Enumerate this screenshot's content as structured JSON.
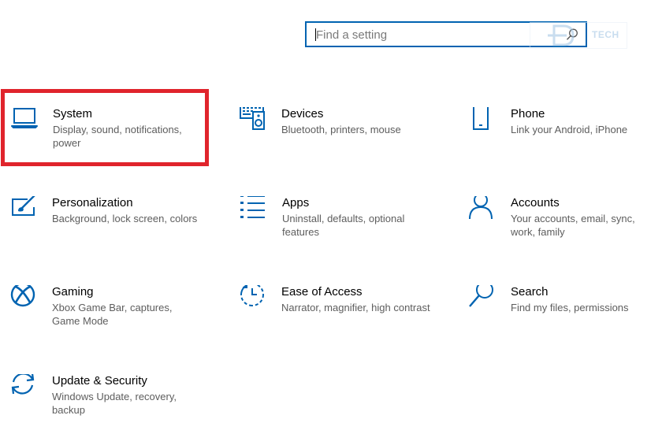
{
  "search": {
    "placeholder": "Find a setting",
    "value": ""
  },
  "watermark": {
    "text": "TECH"
  },
  "colors": {
    "accent": "#0063b1",
    "highlight": "#e0242c",
    "description": "#5d5d5d"
  },
  "categories": [
    {
      "id": "system",
      "icon": "laptop-icon",
      "title": "System",
      "description": "Display, sound, notifications, power",
      "highlighted": true
    },
    {
      "id": "devices",
      "icon": "keyboard-speaker-icon",
      "title": "Devices",
      "description": "Bluetooth, printers, mouse"
    },
    {
      "id": "phone",
      "icon": "phone-icon",
      "title": "Phone",
      "description": "Link your Android, iPhone"
    },
    {
      "id": "personalization",
      "icon": "paintbrush-icon",
      "title": "Personalization",
      "description": "Background, lock screen, colors"
    },
    {
      "id": "apps",
      "icon": "apps-list-icon",
      "title": "Apps",
      "description": "Uninstall, defaults, optional features"
    },
    {
      "id": "accounts",
      "icon": "person-icon",
      "title": "Accounts",
      "description": "Your accounts, email, sync, work, family"
    },
    {
      "id": "gaming",
      "icon": "xbox-icon",
      "title": "Gaming",
      "description": "Xbox Game Bar, captures, Game Mode"
    },
    {
      "id": "ease-of-access",
      "icon": "ease-of-access-icon",
      "title": "Ease of Access",
      "description": "Narrator, magnifier, high contrast"
    },
    {
      "id": "search",
      "icon": "magnifier-icon",
      "title": "Search",
      "description": "Find my files, permissions"
    },
    {
      "id": "update-security",
      "icon": "sync-arrows-icon",
      "title": "Update & Security",
      "description": "Windows Update, recovery, backup"
    }
  ]
}
